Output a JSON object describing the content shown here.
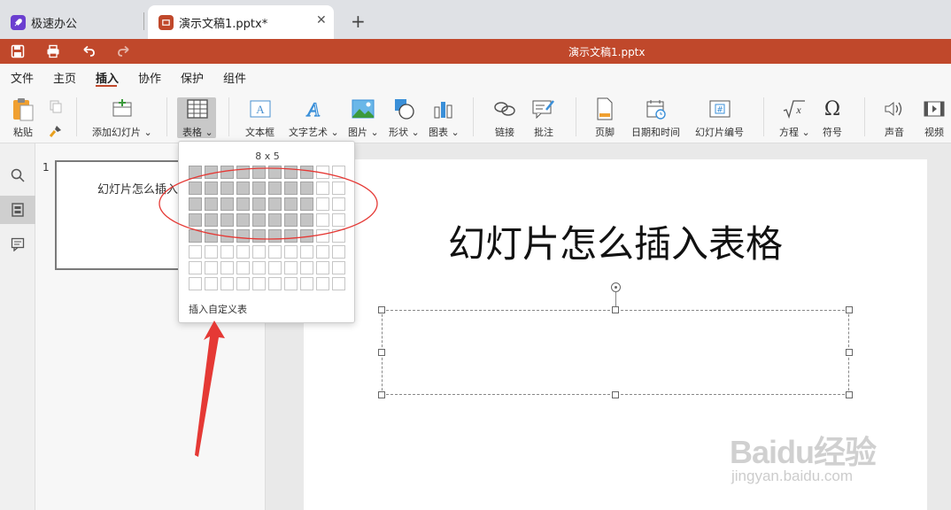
{
  "tabs": [
    {
      "label": "极速办公",
      "icon": "rocket-icon"
    },
    {
      "label": "演示文稿1.pptx*",
      "icon": "presentation-icon"
    }
  ],
  "title_bar": {
    "filename": "演示文稿1.pptx"
  },
  "menus": [
    "文件",
    "主页",
    "插入",
    "协作",
    "保护",
    "组件"
  ],
  "active_menu": "插入",
  "ribbon": {
    "paste": "粘贴",
    "add_slide": "添加幻灯片",
    "table": "表格",
    "textbox": "文本框",
    "wordart": "文字艺术",
    "image": "图片",
    "shape": "形状",
    "chart": "图表",
    "link": "链接",
    "comment": "批注",
    "footer": "页脚",
    "datetime": "日期和时间",
    "slide_number": "幻灯片编号",
    "equation": "方程",
    "symbol": "符号",
    "audio": "声音",
    "video": "视频"
  },
  "thumbnail": {
    "number": "1",
    "text": "幻灯片怎么插入"
  },
  "slide": {
    "title": "幻灯片怎么插入表格"
  },
  "table_picker": {
    "size_label": "8 x 5",
    "selected_cols": 8,
    "selected_rows": 5,
    "total_cols": 10,
    "total_rows": 8,
    "custom_label": "插入自定义表"
  },
  "watermark": {
    "brand": "Baidu经验",
    "url": "jingyan.baidu.com"
  },
  "colors": {
    "brand": "#c0482b",
    "accent": "#c0482b",
    "annotation": "#e53935"
  }
}
